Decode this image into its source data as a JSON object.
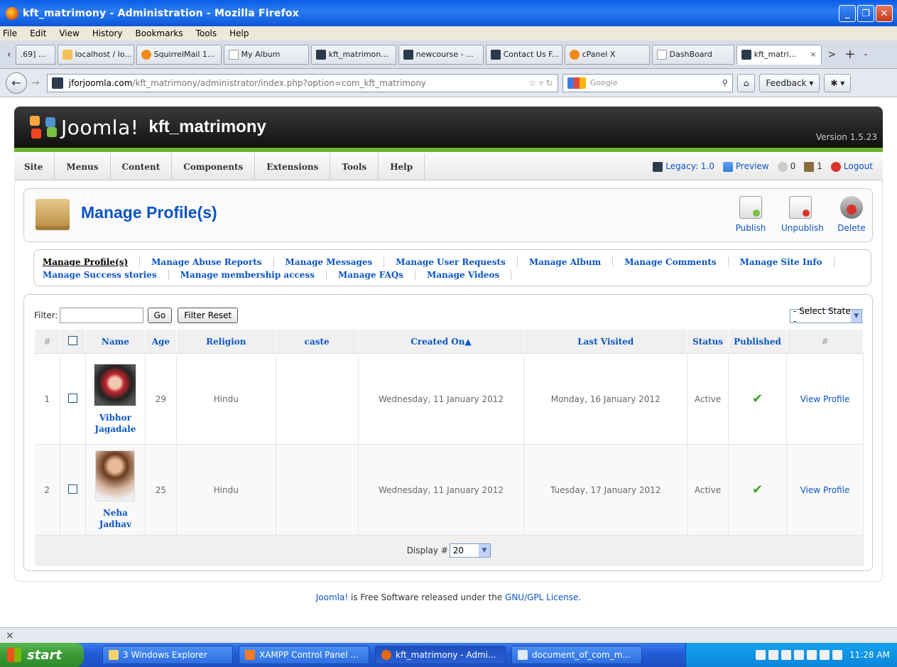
{
  "window": {
    "title": "kft_matrimony - Administration - Mozilla Firefox",
    "min": "_",
    "max": "❐",
    "close": "✕"
  },
  "menubar": [
    "File",
    "Edit",
    "View",
    "History",
    "Bookmarks",
    "Tools",
    "Help"
  ],
  "tabs": {
    "prev_partial": ".69] ...",
    "items": [
      {
        "label": "localhost / lo...",
        "icon": "pma"
      },
      {
        "label": "SquirrelMail 1...",
        "icon": "cpanel"
      },
      {
        "label": "My Album",
        "icon": "blank"
      },
      {
        "label": "kft_matrimon...",
        "icon": "joomla"
      },
      {
        "label": "newcourse - ...",
        "icon": "joomla"
      },
      {
        "label": "Contact Us F...",
        "icon": "joomla"
      },
      {
        "label": "cPanel X",
        "icon": "cpanel"
      },
      {
        "label": "DashBoard",
        "icon": "blank"
      }
    ],
    "active": {
      "label": "kft_matri...",
      "close": "×"
    },
    "next": ">",
    "new_tab": "+",
    "list": "-"
  },
  "nav": {
    "url_host": "jforjoomla.com",
    "url_path": "/kft_matrimony/administrator/index.php?option=com_kft_matrimony",
    "search_placeholder": "Google",
    "feedback": "Feedback"
  },
  "joomla": {
    "brand": "Joomla!",
    "site": "kft_matrimony",
    "version": "Version 1.5.23"
  },
  "adminmenu": [
    "Site",
    "Menus",
    "Content",
    "Components",
    "Extensions",
    "Tools",
    "Help"
  ],
  "status": {
    "legacy": "Legacy: 1.0",
    "preview": "Preview",
    "messages": "0",
    "users": "1",
    "logout": "Logout"
  },
  "toolbar": {
    "title": "Manage Profile(s)",
    "publish": "Publish",
    "unpublish": "Unpublish",
    "delete": "Delete"
  },
  "submenu": {
    "row1": [
      "Manage Profile(s)",
      "Manage Abuse Reports",
      "Manage Messages",
      "Manage User Requests",
      "Manage Album",
      "Manage Comments",
      "Manage Site Info"
    ],
    "row2": [
      "Manage Success stories",
      "Manage membership access",
      "Manage FAQs",
      "Manage Videos"
    ]
  },
  "filter": {
    "label": "Filter:",
    "value": "",
    "go": "Go",
    "reset": "Filter Reset",
    "state_select": "- Select State -"
  },
  "table": {
    "headers": [
      "#",
      "",
      "Name",
      "Age",
      "Religion",
      "caste",
      "Created On▲",
      "Last Visited",
      "Status",
      "Published",
      "#"
    ],
    "rows": [
      {
        "num": "1",
        "name": "Vibhor Jagadale",
        "age": "29",
        "religion": "Hindu",
        "caste": "",
        "created": "Wednesday, 11 January 2012",
        "visited": "Monday, 16 January 2012",
        "status": "Active",
        "published": "✔",
        "action": "View Profile"
      },
      {
        "num": "2",
        "name": "Neha Jadhav",
        "age": "25",
        "religion": "Hindu",
        "caste": "",
        "created": "Wednesday, 11 January 2012",
        "visited": "Tuesday, 17 January 2012",
        "status": "Active",
        "published": "✔",
        "action": "View Profile"
      }
    ],
    "display_label": "Display #",
    "display_value": "20"
  },
  "footer": {
    "joomla_link": "Joomla!",
    "text": " is Free Software released under the ",
    "license_link": "GNU/GPL License",
    "end": "."
  },
  "findbar": {
    "close": "×"
  },
  "taskbar": {
    "start": "start",
    "tasks": [
      {
        "label": "3 Windows Explorer",
        "icon": "folder"
      },
      {
        "label": "XAMPP Control Panel ...",
        "icon": "xampp"
      },
      {
        "label": "kft_matrimony - Admi...",
        "icon": "ff"
      },
      {
        "label": "document_of_com_m...",
        "icon": "doc"
      }
    ],
    "clock": "11:28 AM"
  }
}
